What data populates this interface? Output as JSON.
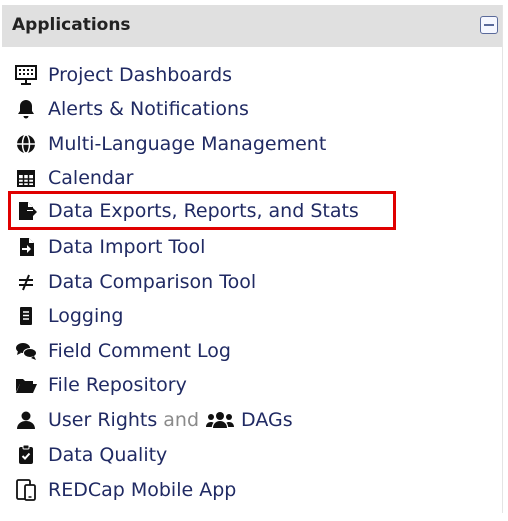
{
  "header": {
    "title": "Applications"
  },
  "items": [
    {
      "label": "Project Dashboards",
      "icon": "dashboard-icon"
    },
    {
      "label": "Alerts & Notifications",
      "icon": "bell-icon"
    },
    {
      "label": "Multi-Language Management",
      "icon": "globe-icon"
    },
    {
      "label": "Calendar",
      "icon": "calendar-icon"
    },
    {
      "label": "Data Exports, Reports, and Stats",
      "icon": "file-export-icon",
      "highlighted": true
    },
    {
      "label": "Data Import Tool",
      "icon": "file-import-icon"
    },
    {
      "label": "Data Comparison Tool",
      "icon": "not-equal-icon"
    },
    {
      "label": "Logging",
      "icon": "list-log-icon"
    },
    {
      "label": "Field Comment Log",
      "icon": "comments-icon"
    },
    {
      "label": "File Repository",
      "icon": "folder-open-icon"
    },
    {
      "label": "User Rights",
      "icon": "user-icon",
      "connector": "and",
      "extra_label": "DAGs",
      "extra_icon": "users-icon"
    },
    {
      "label": "Data Quality",
      "icon": "clipboard-check-icon"
    },
    {
      "label": "REDCap Mobile App",
      "icon": "mobile-tablet-icon"
    }
  ],
  "colors": {
    "link": "#202a63",
    "highlight_border": "#e00000",
    "header_bg": "#e0e0e0",
    "icon": "#111111"
  }
}
